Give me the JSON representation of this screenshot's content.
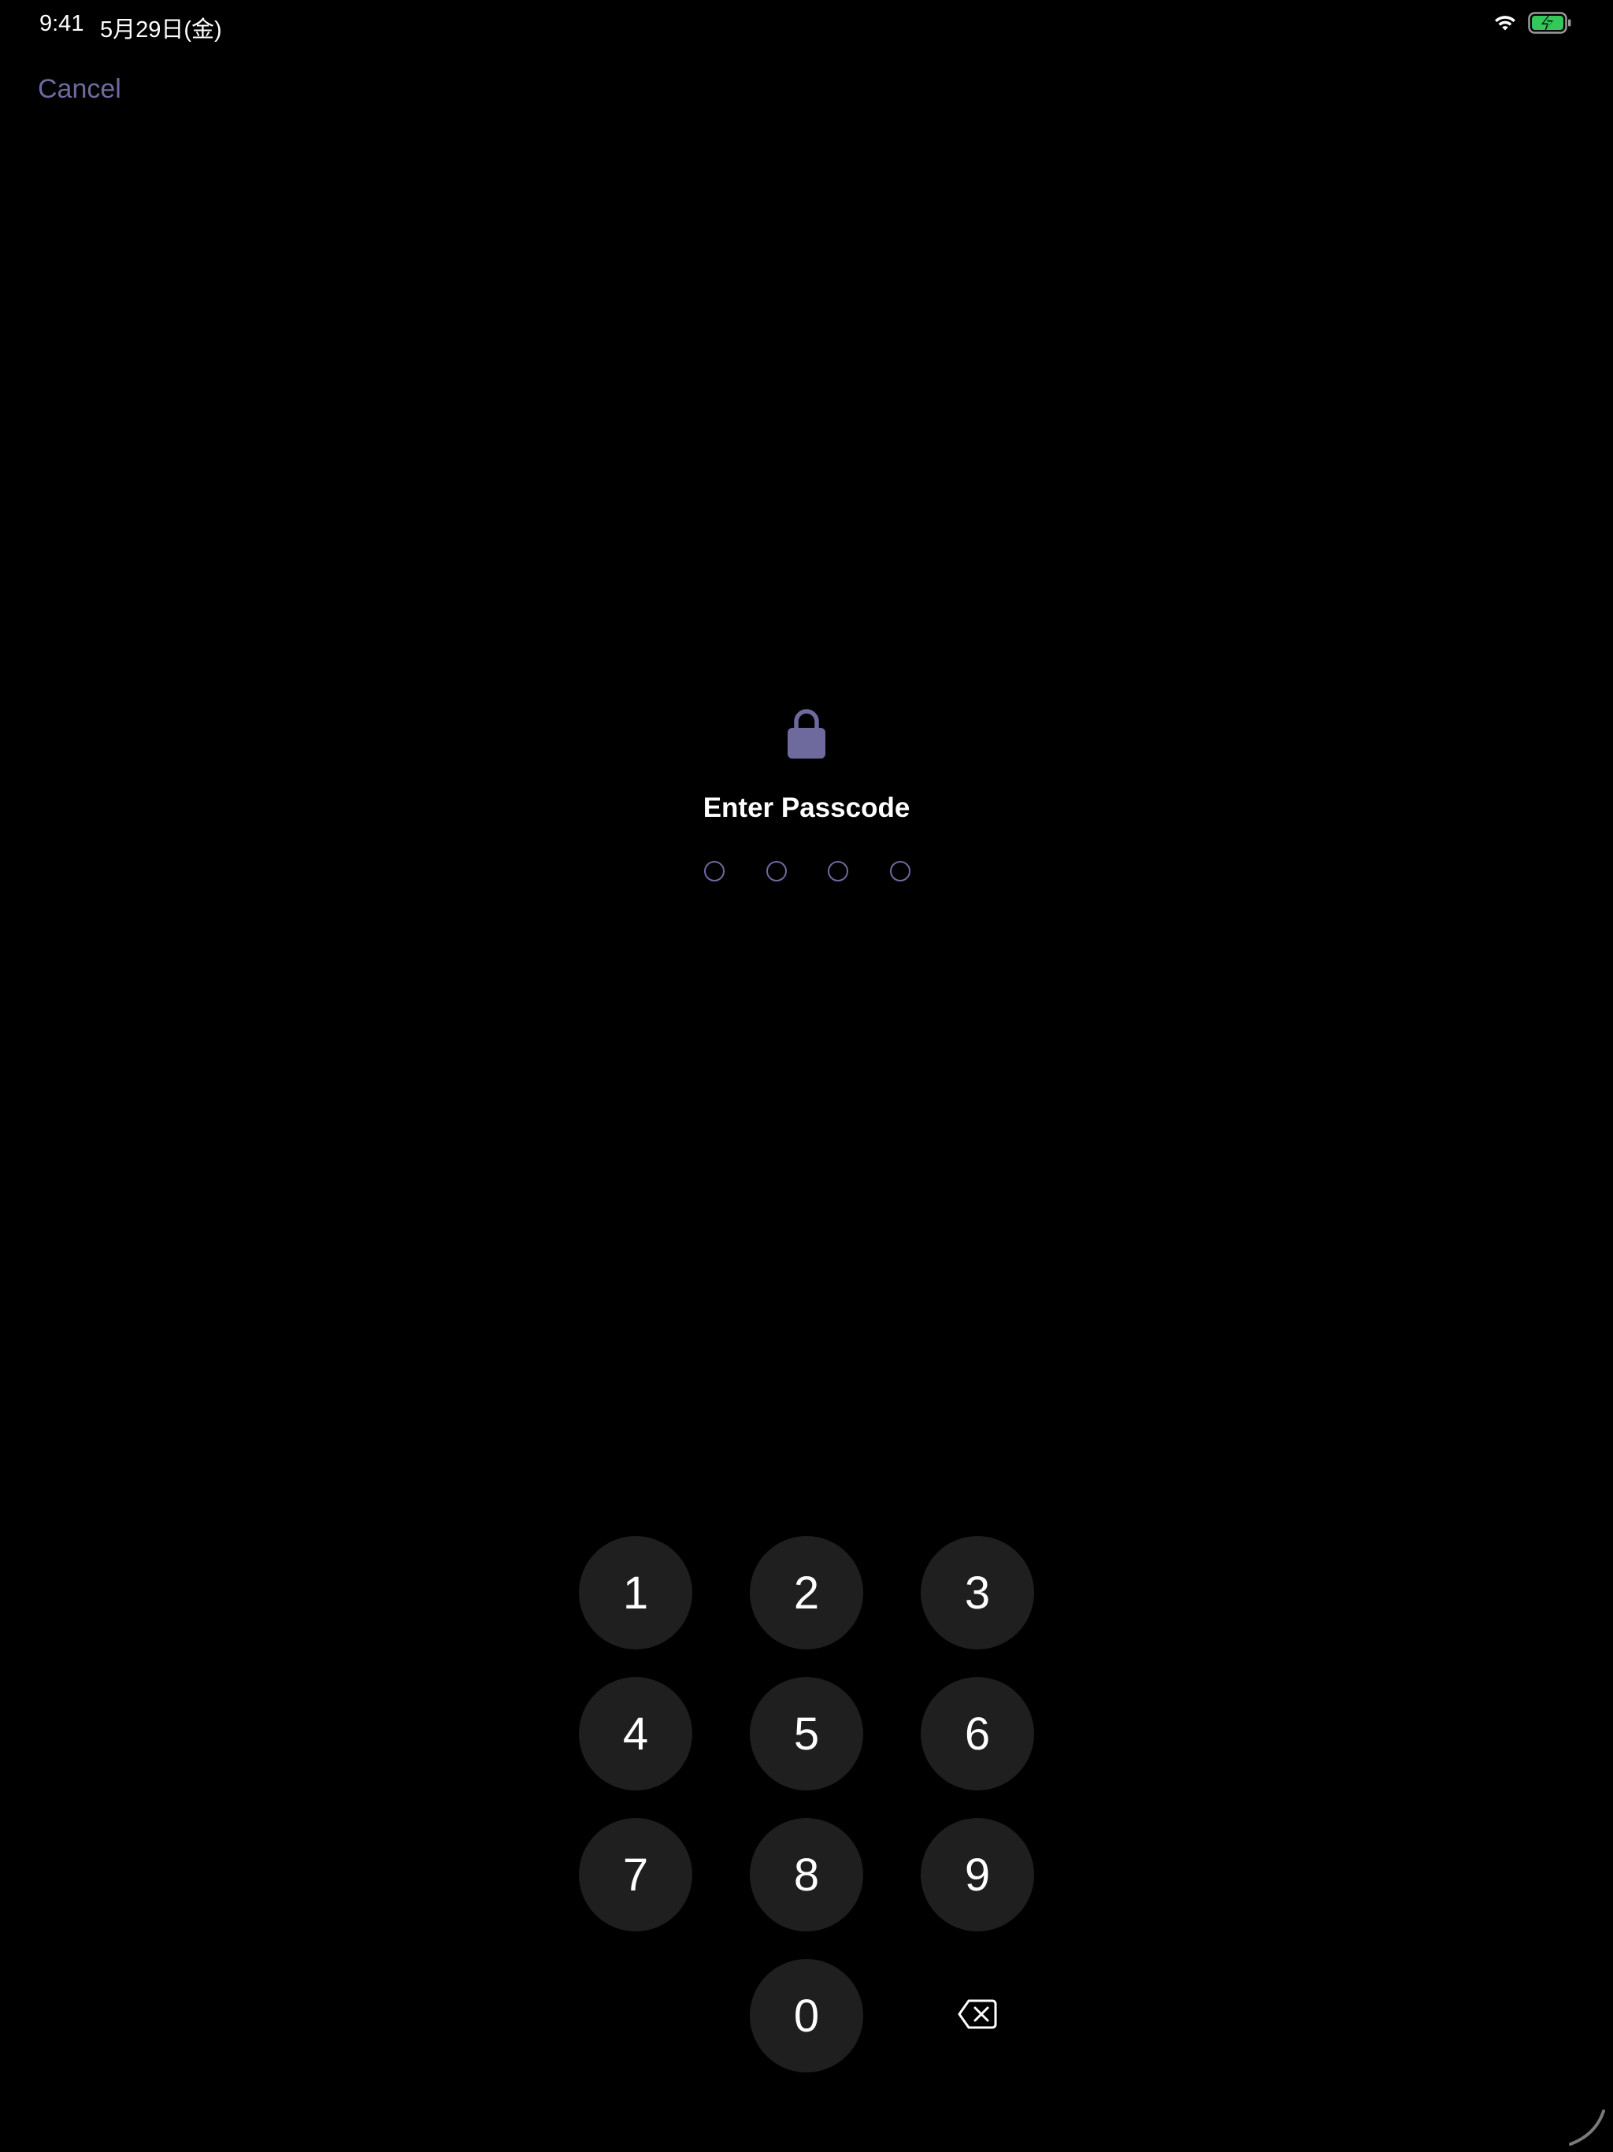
{
  "status_bar": {
    "time": "9:41",
    "date": "5月29日(金)",
    "wifi_icon": "wifi-icon",
    "battery_icon": "battery-charging-icon",
    "battery_color": "#34c759"
  },
  "nav": {
    "cancel_label": "Cancel"
  },
  "passcode": {
    "lock_icon": "lock-icon",
    "prompt": "Enter Passcode",
    "digits_total": 4,
    "digits_entered": 0
  },
  "keypad": {
    "keys": [
      "1",
      "2",
      "3",
      "4",
      "5",
      "6",
      "7",
      "8",
      "9",
      "0"
    ],
    "delete_icon": "delete-backspace-icon"
  },
  "colors": {
    "accent": "#6e6a9e",
    "background": "#000000",
    "key_background": "#1f1f1f",
    "text": "#ffffff"
  }
}
